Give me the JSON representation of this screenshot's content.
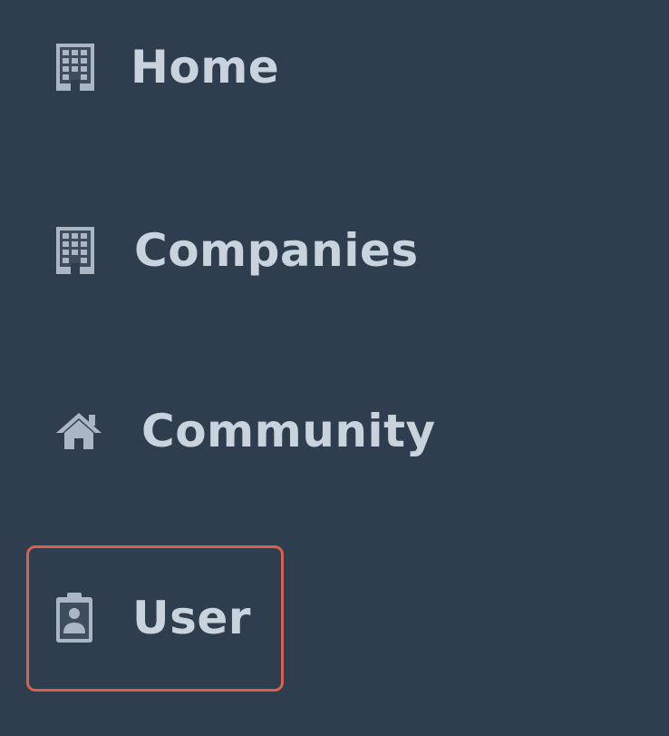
{
  "sidebar": {
    "items": [
      {
        "label": "Home",
        "icon": "building-icon"
      },
      {
        "label": "Companies",
        "icon": "building-icon"
      },
      {
        "label": "Community",
        "icon": "home-icon"
      },
      {
        "label": "User",
        "icon": "user-badge-icon"
      }
    ],
    "active_item": "User",
    "colors": {
      "background": "#2f3e4e",
      "text": "#c9d3de",
      "icon": "#aab6c3",
      "highlight_border": "#d9614b"
    }
  }
}
